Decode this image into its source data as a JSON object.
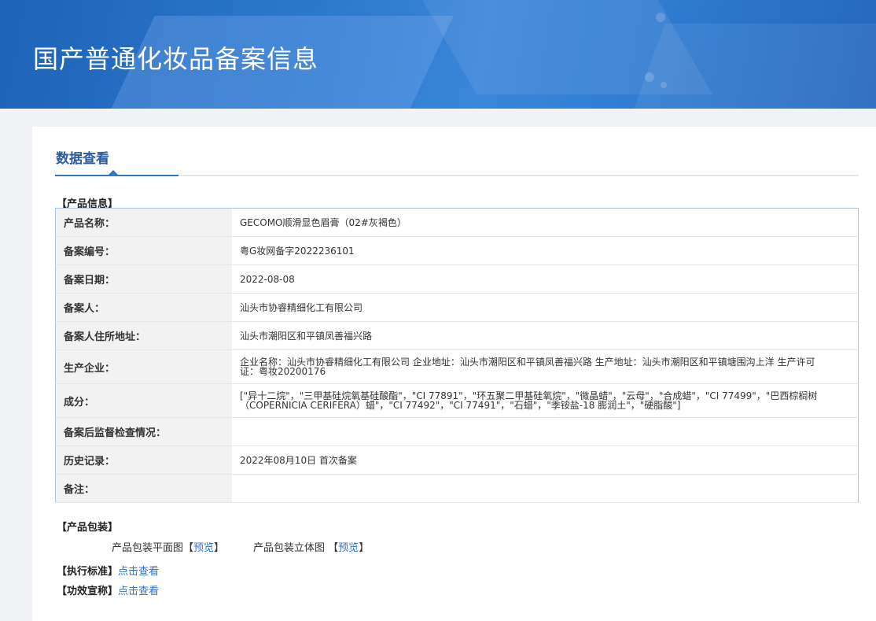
{
  "header": {
    "title": "国产普通化妆品备案信息"
  },
  "tab": {
    "label": "数据查看"
  },
  "product_info": {
    "section_title": "【产品信息】",
    "rows": [
      {
        "label": "产品名称：",
        "value": "GECOMO顺滑显色眉膏（02#灰褐色）"
      },
      {
        "label": "备案编号：",
        "value": "粤G妆网备字2022236101"
      },
      {
        "label": "备案日期：",
        "value": "2022-08-08"
      },
      {
        "label": "备案人：",
        "value": "汕头市协睿精细化工有限公司"
      },
      {
        "label": "备案人住所地址：",
        "value": "汕头市潮阳区和平镇凤善福兴路"
      },
      {
        "label": "生产企业：",
        "value": "企业名称：汕头市协睿精细化工有限公司 企业地址：汕头市潮阳区和平镇凤善福兴路 生产地址：汕头市潮阳区和平镇塘围沟上洋 生产许可证：粤妆20200176"
      },
      {
        "label": "成分：",
        "value": "[\"异十二烷\"，\"三甲基硅烷氧基硅酸酯\"，\"CI 77891\"，\"环五聚二甲基硅氧烷\"，\"微晶蜡\"，\"云母\"，\"合成蜡\"，\"CI 77499\"，\"巴西棕榈树（COPERNICIA CERIFERA）蜡\"，\"CI 77492\"，\"CI 77491\"，\"石蜡\"，\"季铵盐-18 膨润土\"，\"硬脂酸\"]"
      },
      {
        "label": "备案后监督检查情况：",
        "value": ""
      },
      {
        "label": "历史记录：",
        "value": "2022年08月10日 首次备案"
      },
      {
        "label": "备注：",
        "value": ""
      }
    ]
  },
  "packaging": {
    "section_title": "【产品包装】",
    "flat_label": "产品包装平面图",
    "solid_label": "产品包装立体图",
    "bracket_open": "【",
    "bracket_close": "】",
    "preview": "预览"
  },
  "standard": {
    "section_title": "【执行标准】",
    "link": "点击查看"
  },
  "efficacy": {
    "section_title": "【功效宣称】",
    "link": "点击查看"
  }
}
